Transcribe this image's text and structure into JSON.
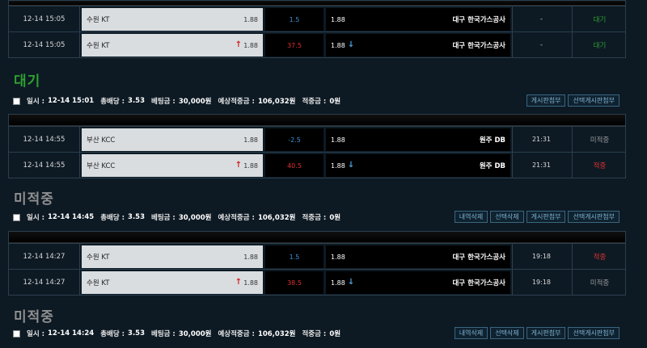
{
  "slips": [
    {
      "rows": [
        {
          "time": "12-14 15:05",
          "home": "수원 KT",
          "home_odds": "1.88",
          "home_up": false,
          "handicap": "1.5",
          "hc_color": "#3e8fd6",
          "away_odds": "1.88",
          "away_down": false,
          "away": "대구 한국가스공사",
          "score": "-",
          "result": "대기",
          "result_class": "result-wait"
        },
        {
          "time": "12-14 15:05",
          "home": "수원 KT",
          "home_odds": "1.88",
          "home_up": true,
          "handicap": "37.5",
          "hc_color": "#e03030",
          "away_odds": "1.88",
          "away_down": true,
          "away": "대구 한국가스공사",
          "score": "-",
          "result": "대기",
          "result_class": "result-wait"
        }
      ],
      "status": {
        "text": "대기",
        "color": "#2ea02e"
      },
      "info": {
        "date_label": "일시 :",
        "date": "12-14 15:01",
        "odds_label": "총배당 :",
        "odds": "3.53",
        "bet_label": "베팅금 :",
        "bet": "30,000원",
        "expected_label": "예상적중금 :",
        "expected": "106,032원",
        "hit_label": "적중금 :",
        "hit": "0원"
      },
      "buttons": [
        "게시판첨부",
        "선택게시판첨부"
      ]
    },
    {
      "rows": [
        {
          "time": "12-14 14:55",
          "home": "부산 KCC",
          "home_odds": "1.88",
          "home_up": false,
          "handicap": "-2.5",
          "hc_color": "#3e8fd6",
          "away_odds": "1.88",
          "away_down": false,
          "away": "원주 DB",
          "score": "21:31",
          "result": "미적중",
          "result_class": "result-miss"
        },
        {
          "time": "12-14 14:55",
          "home": "부산 KCC",
          "home_odds": "1.88",
          "home_up": true,
          "handicap": "40.5",
          "hc_color": "#e03030",
          "away_odds": "1.88",
          "away_down": true,
          "away": "원주 DB",
          "score": "21:31",
          "result": "적중",
          "result_class": "result-hit"
        }
      ],
      "status": {
        "text": "미적중",
        "color": "#8f8f8f"
      },
      "info": {
        "date_label": "일시 :",
        "date": "12-14 14:45",
        "odds_label": "총배당 :",
        "odds": "3.53",
        "bet_label": "베팅금 :",
        "bet": "30,000원",
        "expected_label": "예상적중금 :",
        "expected": "106,032원",
        "hit_label": "적중금 :",
        "hit": "0원"
      },
      "buttons": [
        "내역삭제",
        "선택삭제",
        "게시판첨부",
        "선택게시판첨부"
      ]
    },
    {
      "rows": [
        {
          "time": "12-14 14:27",
          "home": "수원 KT",
          "home_odds": "1.88",
          "home_up": false,
          "handicap": "1.5",
          "hc_color": "#3e8fd6",
          "away_odds": "1.88",
          "away_down": false,
          "away": "대구 한국가스공사",
          "score": "19:18",
          "result": "적중",
          "result_class": "result-hit"
        },
        {
          "time": "12-14 14:27",
          "home": "수원 KT",
          "home_odds": "1.88",
          "home_up": true,
          "handicap": "38.5",
          "hc_color": "#e03030",
          "away_odds": "1.88",
          "away_down": true,
          "away": "대구 한국가스공사",
          "score": "19:18",
          "result": "미적중",
          "result_class": "result-miss"
        }
      ],
      "status": {
        "text": "미적중",
        "color": "#8f8f8f"
      },
      "info": {
        "date_label": "일시 :",
        "date": "12-14 14:24",
        "odds_label": "총배당 :",
        "odds": "3.53",
        "bet_label": "베팅금 :",
        "bet": "30,000원",
        "expected_label": "예상적중금 :",
        "expected": "106,032원",
        "hit_label": "적중금 :",
        "hit": "0원"
      },
      "buttons": [
        "내역삭제",
        "선택삭제",
        "게시판첨부",
        "선택게시판첨부"
      ]
    }
  ],
  "icons": {
    "up": "up-arrow-icon",
    "down": "down-arrow-icon"
  }
}
